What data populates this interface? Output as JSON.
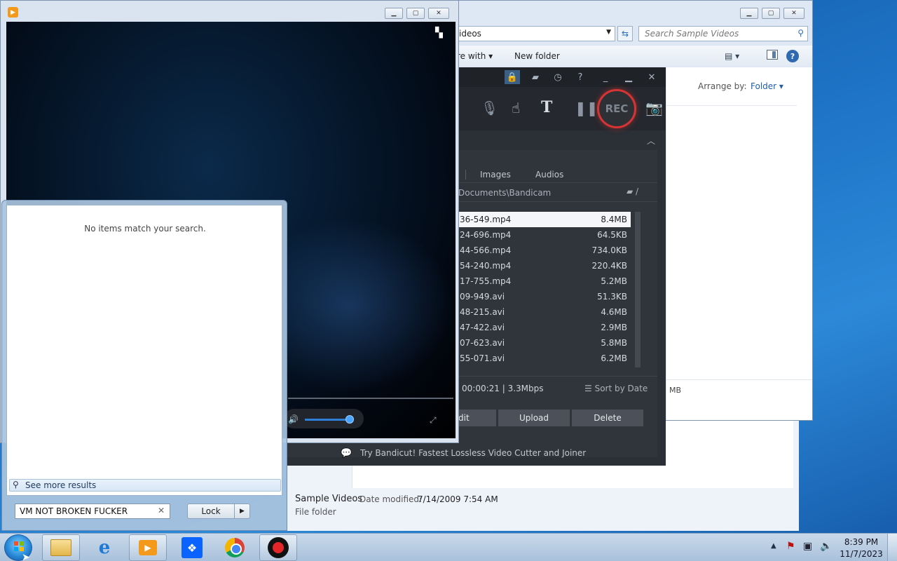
{
  "explorer": {
    "address": "ideos",
    "search_placeholder": "Search Sample Videos",
    "toolbar": {
      "share": "re with ▾",
      "new_folder": "New folder"
    },
    "arrange_label": "Arrange by:",
    "arrange_value": "Folder ▾",
    "status_text": "MB",
    "details": {
      "name": "Sample Videos",
      "date_label": "Date modified:",
      "date_value": "7/14/2009 7:54 AM",
      "type": "File folder"
    }
  },
  "bandicam": {
    "rec_label": "REC",
    "tabs": {
      "images": "Images",
      "audios": "Audios"
    },
    "path": "Documents\\Bandicam",
    "path_suffix": "/",
    "files": [
      {
        "name": "36-549.mp4",
        "size": "8.4MB"
      },
      {
        "name": "24-696.mp4",
        "size": "64.5KB"
      },
      {
        "name": "44-566.mp4",
        "size": "734.0KB"
      },
      {
        "name": "54-240.mp4",
        "size": "220.4KB"
      },
      {
        "name": "17-755.mp4",
        "size": "5.2MB"
      },
      {
        "name": "09-949.avi",
        "size": "51.3KB"
      },
      {
        "name": "48-215.avi",
        "size": "4.6MB"
      },
      {
        "name": "47-422.avi",
        "size": "2.9MB"
      },
      {
        "name": "07-623.avi",
        "size": "5.8MB"
      },
      {
        "name": "55-071.avi",
        "size": "6.2MB"
      }
    ],
    "duration": "00:00:21 | 3.3Mbps",
    "sort": "Sort by Date",
    "buttons": {
      "edit": "dit",
      "upload": "Upload",
      "delete": "Delete"
    },
    "promo": "Try Bandicut! Fastest Lossless Video Cutter and Joiner"
  },
  "startmenu": {
    "no_results": "No items match your search.",
    "see_more": "See more results",
    "search_value": "VM NOT BROKEN FUCKER",
    "lock_label": "Lock"
  },
  "taskbar": {
    "time": "8:39 PM",
    "date": "11/7/2023"
  },
  "colors": {
    "desktop": "#1e73c6",
    "bandicam_bg": "#2b2f36",
    "rec_ring": "#d63434",
    "accent_link": "#1f5fa6"
  }
}
